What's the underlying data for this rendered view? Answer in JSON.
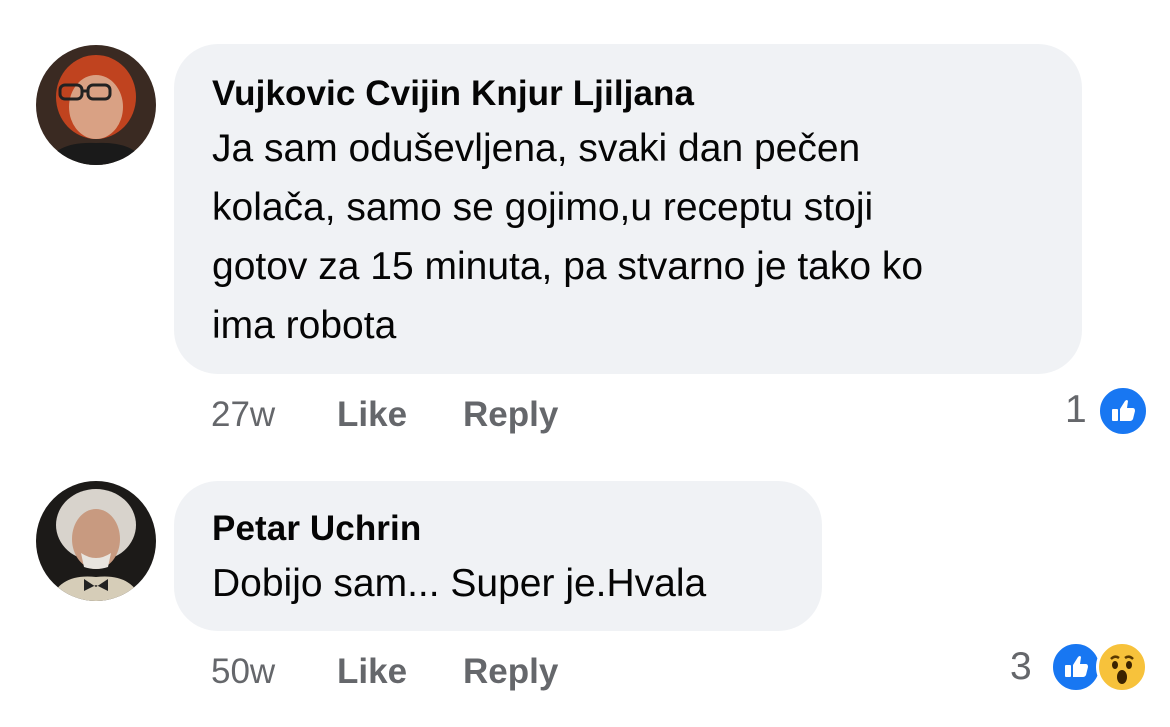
{
  "comments": [
    {
      "author": "Vujkovic Cvijin Knjur Ljiljana",
      "text_lines": [
        "Ja sam oduševljena, svaki dan pečen",
        "kolača, samo se gojimo,u receptu stoji",
        "gotov za 15 minuta, pa stvarno je tako ko",
        "ima robota"
      ],
      "time": "27w",
      "like_label": "Like",
      "reply_label": "Reply",
      "reaction_count": "1",
      "reactions": [
        "like-icon"
      ]
    },
    {
      "author": "Petar Uchrin",
      "text_lines": [
        "Dobijo sam... Super je.Hvala"
      ],
      "time": "50w",
      "like_label": "Like",
      "reply_label": "Reply",
      "reaction_count": "3",
      "reactions": [
        "like-icon",
        "wow-icon"
      ]
    }
  ],
  "colors": {
    "bubble": "#f0f2f5",
    "secondary_text": "#65676b",
    "like_blue": "#1877f2",
    "wow_yellow": "#f7c23b"
  }
}
